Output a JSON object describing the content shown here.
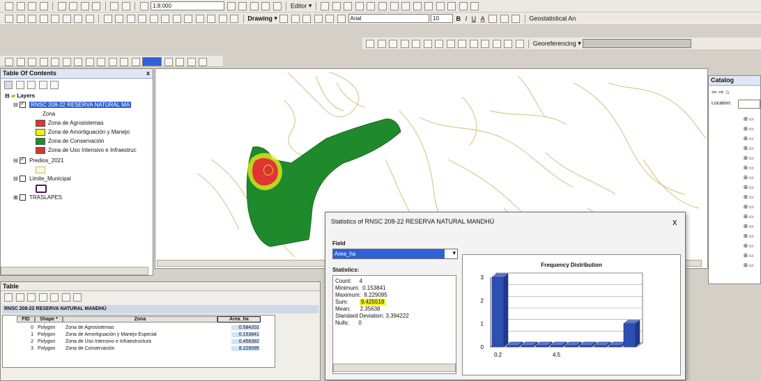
{
  "toolbar": {
    "scale": "1:8.000",
    "editor": "Editor",
    "drawing": "Drawing",
    "font": "Arial",
    "font_size": "10",
    "geostatistical": "Geostatistical An",
    "georeferencing": "Georeferencing"
  },
  "toc": {
    "title": "Table Of Contents",
    "close": "x",
    "layers": "Layers",
    "layer_main": "RNSC 208-22 RESERVA NATURAL MA",
    "layer_main_field": "Zona",
    "legend": [
      {
        "label": "Zona de Agrosistemas",
        "color": "#e13434"
      },
      {
        "label": "Zona de Amortiguación y Manejo",
        "color": "#f2ee1b"
      },
      {
        "label": "Zona de Conservación",
        "color": "#1f8a2b"
      },
      {
        "label": "Zona de Uso Intensivo e Infraestruc",
        "color": "#d63532"
      }
    ],
    "predios": "Predios_2021",
    "limite": "Limite_Municipal",
    "traslapes": "TRASLAPES"
  },
  "table": {
    "title": "Table",
    "layer_title": "RNSC 208-22 RESERVA NATURAL MANDHÚ",
    "columns": [
      "FID",
      "Shape *",
      "Zona",
      "Area_ha"
    ],
    "rows": [
      [
        "0",
        "Polygon",
        "Zona de Agrosistemas",
        "0.584202"
      ],
      [
        "1",
        "Polygon",
        "Zona de Amortiguación y Manejo Especial",
        "0.153841"
      ],
      [
        "2",
        "Polygon",
        "Zona de Uso Intensivo e Infraestructura",
        "0.458382"
      ],
      [
        "3",
        "Polygon",
        "Zona de Conservación",
        "8.229095"
      ]
    ]
  },
  "catalog": {
    "title": "Catalog",
    "location": "Location:"
  },
  "stats": {
    "title": "Statistics of RNSC 208-22 RESERVA NATURAL MANDHÚ",
    "close": "x",
    "field_label": "Field",
    "field_value": "Area_ha",
    "statistics_label": "Statistics:",
    "count": "Count:     4",
    "minimum": "Minimum:  0.153841",
    "maximum": "Maximum:  8.229095",
    "sum_label": "Sum:",
    "sum_value": "9.425519",
    "mean": "Mean:      2.35638",
    "std": "Standard Deviation: 3.394222",
    "nulls": "Nulls:      0",
    "chart_title": "Frequency Distribution"
  },
  "chart_data": {
    "type": "bar",
    "title": "Frequency Distribution",
    "x_tick_labels": [
      "0.2",
      "4.5"
    ],
    "bins": 10,
    "values": [
      3,
      0,
      0,
      0,
      0,
      0,
      0,
      0,
      0,
      1
    ],
    "ylim": [
      0,
      3
    ],
    "y_ticks": [
      0,
      0.5,
      1,
      1.5,
      2,
      2.5,
      3
    ],
    "grid": true,
    "colors": {
      "bar": "#2d4fb1"
    }
  },
  "colors": {
    "selection": "#2f62d6",
    "zone_green": "#1f8a2b",
    "zone_red": "#e13434",
    "highlight": "#f3f10f"
  }
}
